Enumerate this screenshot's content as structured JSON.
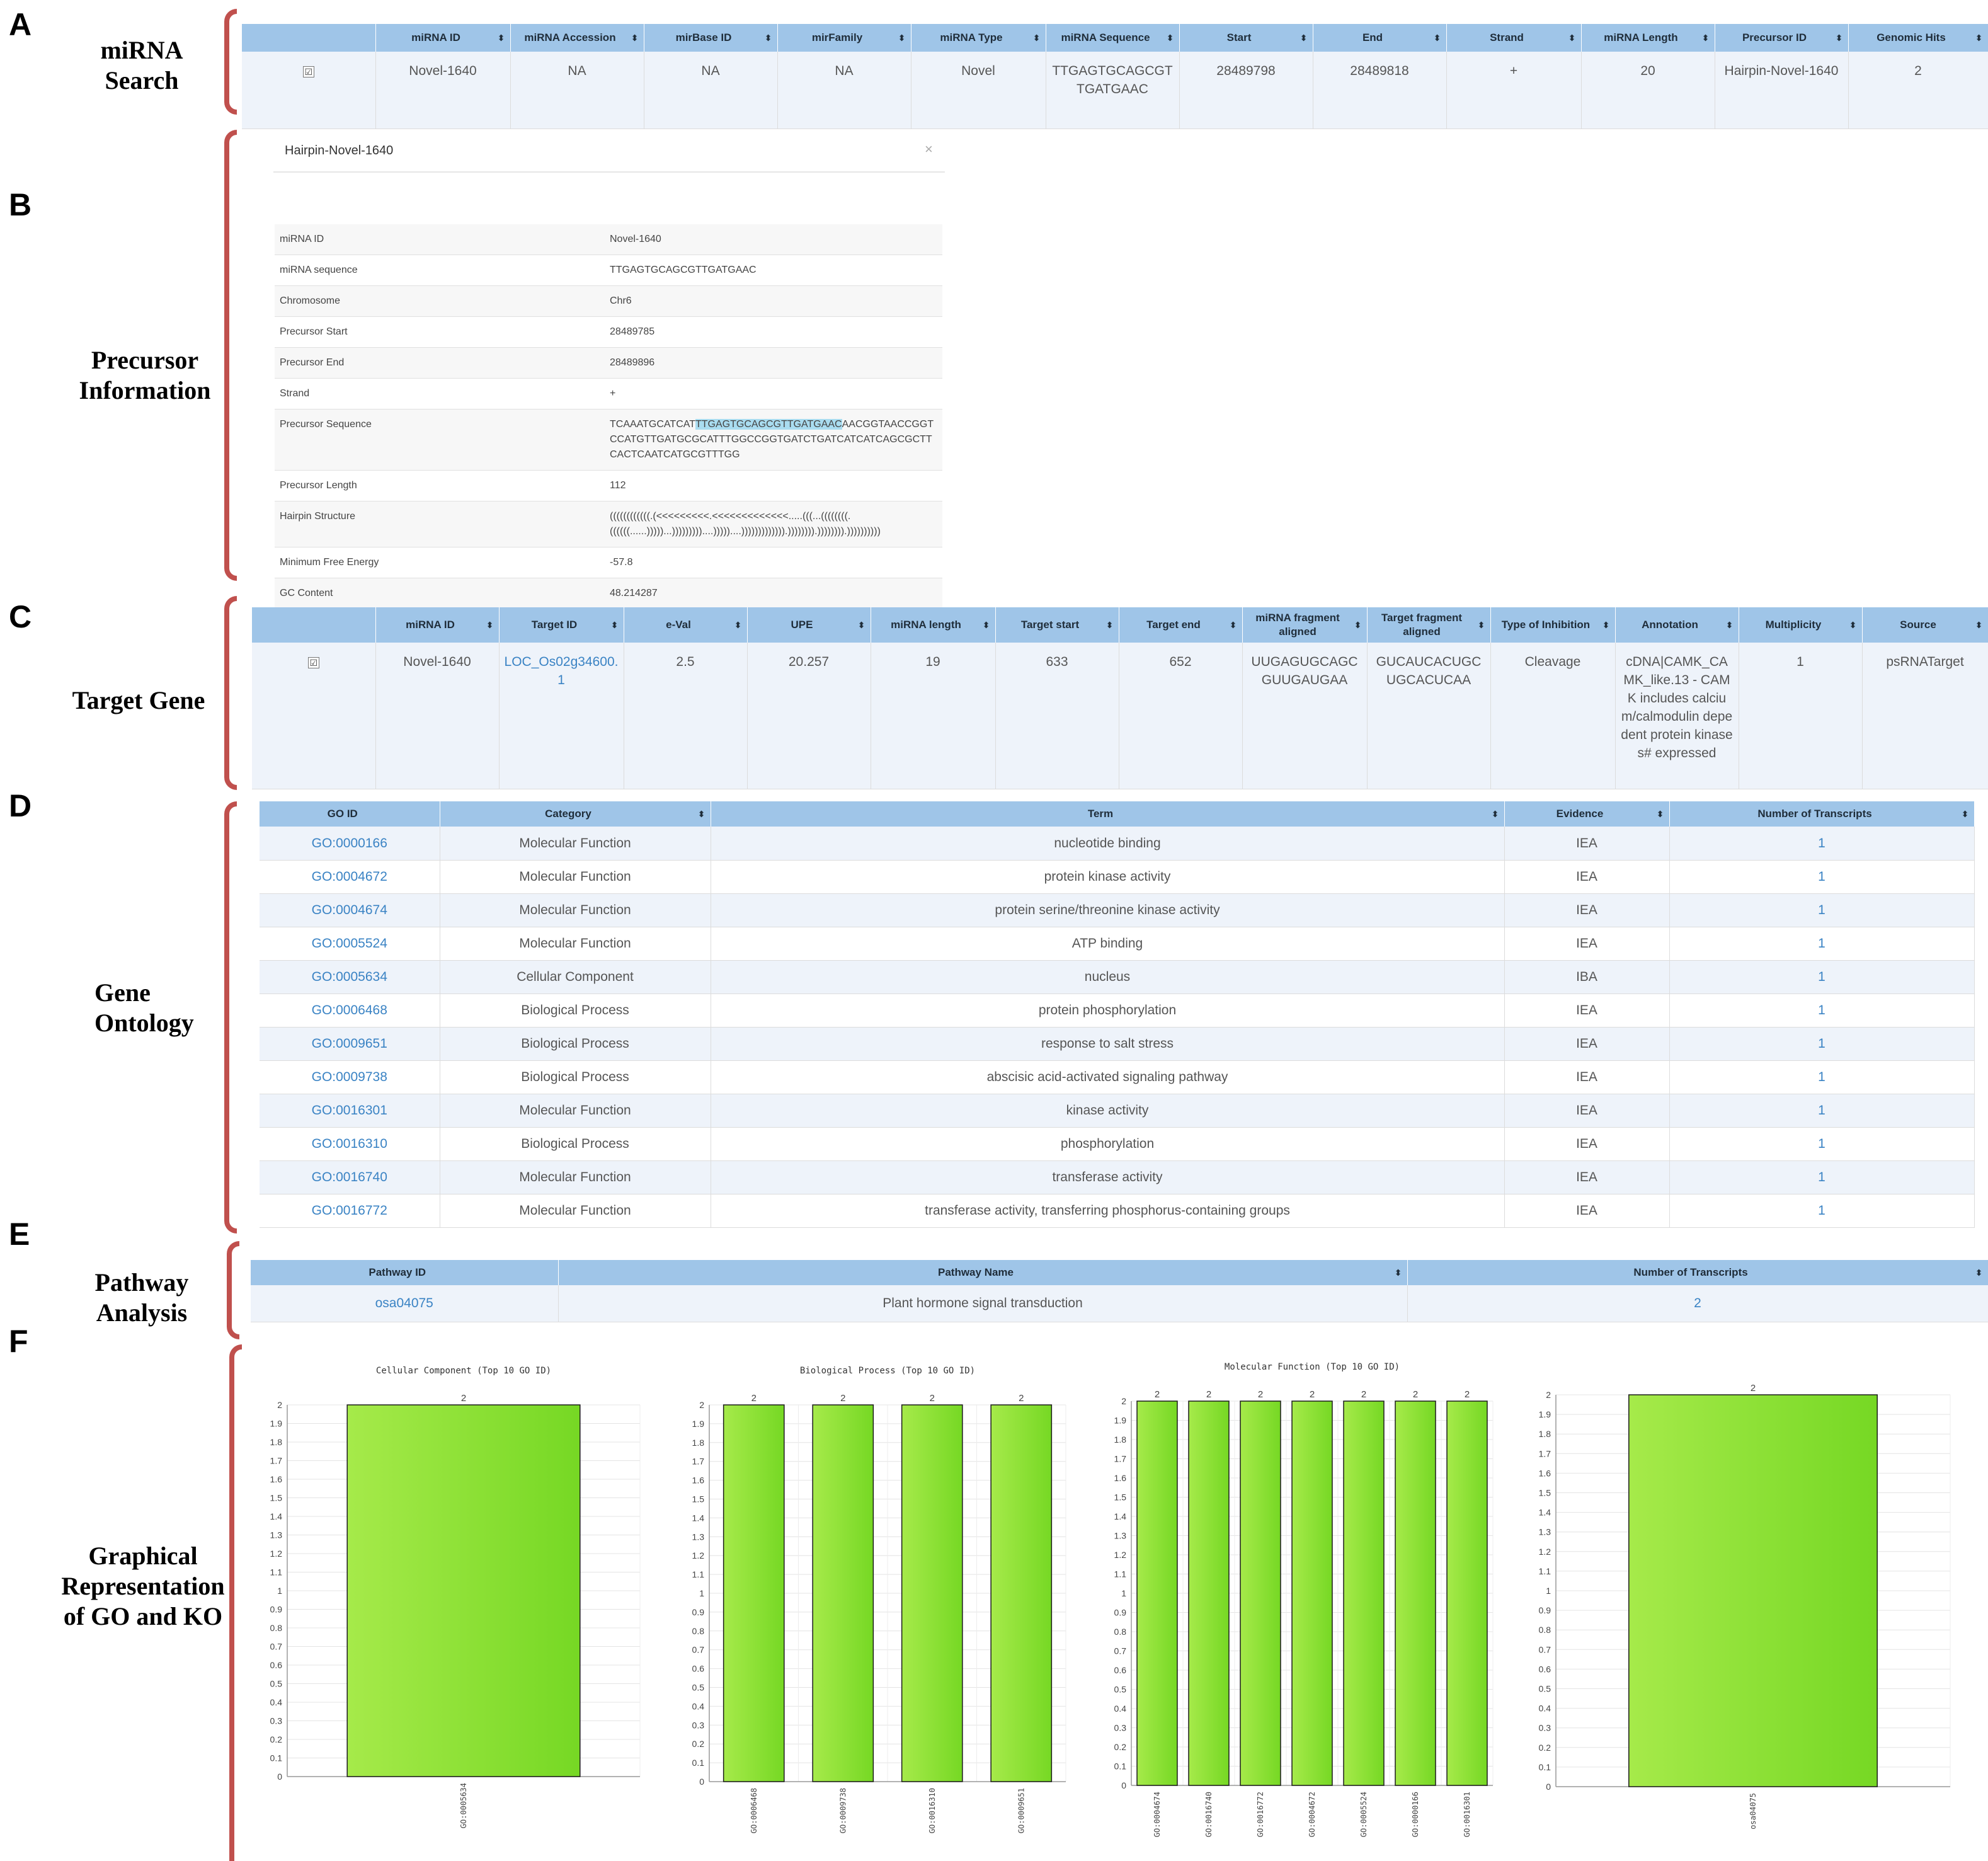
{
  "sections": {
    "a": {
      "letter": "A",
      "label": [
        "miRNA",
        "Search"
      ]
    },
    "b": {
      "letter": "B",
      "label": [
        "Precursor",
        "Information"
      ]
    },
    "c": {
      "letter": "C",
      "label": [
        "Target Gene"
      ]
    },
    "d": {
      "letter": "D",
      "label": [
        "Gene",
        "Ontology"
      ]
    },
    "e": {
      "letter": "E",
      "label": [
        "Pathway",
        "Analysis"
      ]
    },
    "f": {
      "letter": "F",
      "label": [
        "Graphical",
        "Representation",
        "of GO and KO"
      ]
    }
  },
  "mirna_search": {
    "headers": [
      "",
      "miRNA ID",
      "miRNA Accession",
      "mirBase ID",
      "mirFamily",
      "miRNA Type",
      "miRNA Sequence",
      "Start",
      "End",
      "Strand",
      "miRNA Length",
      "Precursor ID",
      "Genomic Hits"
    ],
    "row": [
      "Novel-1640",
      "NA",
      "NA",
      "NA",
      "Novel",
      "TTGAGTGCAGCGTTGATGAAC",
      "28489798",
      "28489818",
      "+",
      "20",
      "Hairpin-Novel-1640",
      "2"
    ]
  },
  "precursor": {
    "title": "Hairpin-Novel-1640",
    "close": "×",
    "rows": [
      {
        "label": "miRNA ID",
        "value": "Novel-1640"
      },
      {
        "label": "miRNA sequence",
        "value": "TTGAGTGCAGCGTTGATGAAC"
      },
      {
        "label": "Chromosome",
        "value": "Chr6"
      },
      {
        "label": "Precursor Start",
        "value": "28489785"
      },
      {
        "label": "Precursor End",
        "value": "28489896"
      },
      {
        "label": "Strand",
        "value": "+"
      },
      {
        "label": "Precursor Sequence",
        "value_pre": "TCAAATGCATCAT",
        "value_hl": "TTGAGTGCAGCGTTGATGAAC",
        "value_post": "AACGGTAACCGGTCCATGTTGATGCGCATTTGGCCGGTGATCTGATCATCATCAGCGCTTCACTCAATCATGCGTTTGG"
      },
      {
        "label": "Precursor Length",
        "value": "112"
      },
      {
        "label": "Hairpin Structure",
        "value": "((((((((((((.(<<<<<<<<<.<<<<<<<<<<<<<.....(((...((((((((.((((((......)))))...)))))))))....)))))....))))))))))))).)))))))).)))))))).))))))))))"
      },
      {
        "label": "Minimum Free Energy",
        "value": "-57.8"
      },
      {
        "label": "GC Content",
        "value": "48.214287"
      }
    ]
  },
  "target_gene": {
    "headers": [
      "",
      "miRNA ID",
      "Target ID",
      "e-Val",
      "UPE",
      "miRNA length",
      "Target start",
      "Target end",
      "miRNA fragment aligned",
      "Target fragment aligned",
      "Type of Inhibition",
      "Annotation",
      "Multiplicity",
      "Source"
    ],
    "row": [
      "Novel-1640",
      "LOC_Os02g34600.1",
      "2.5",
      "20.257",
      "19",
      "633",
      "652",
      "UUGAGUGCAGCGUUGAUGAA",
      "GUCAUCACUGCUGCACUCAA",
      "Cleavage",
      "cDNA|CAMK_CAMK_like.13 - CAMK includes calcium/calmodulin depedent protein kinases# expressed",
      "1",
      "psRNATarget"
    ]
  },
  "gene_ontology": {
    "headers": [
      "GO ID",
      "Category",
      "Term",
      "Evidence",
      "Number of Transcripts"
    ],
    "rows": [
      [
        "GO:0000166",
        "Molecular Function",
        "nucleotide binding",
        "IEA",
        "1"
      ],
      [
        "GO:0004672",
        "Molecular Function",
        "protein kinase activity",
        "IEA",
        "1"
      ],
      [
        "GO:0004674",
        "Molecular Function",
        "protein serine/threonine kinase activity",
        "IEA",
        "1"
      ],
      [
        "GO:0005524",
        "Molecular Function",
        "ATP binding",
        "IEA",
        "1"
      ],
      [
        "GO:0005634",
        "Cellular Component",
        "nucleus",
        "IBA",
        "1"
      ],
      [
        "GO:0006468",
        "Biological Process",
        "protein phosphorylation",
        "IEA",
        "1"
      ],
      [
        "GO:0009651",
        "Biological Process",
        "response to salt stress",
        "IEA",
        "1"
      ],
      [
        "GO:0009738",
        "Biological Process",
        "abscisic acid-activated signaling pathway",
        "IEA",
        "1"
      ],
      [
        "GO:0016301",
        "Molecular Function",
        "kinase activity",
        "IEA",
        "1"
      ],
      [
        "GO:0016310",
        "Biological Process",
        "phosphorylation",
        "IEA",
        "1"
      ],
      [
        "GO:0016740",
        "Molecular Function",
        "transferase activity",
        "IEA",
        "1"
      ],
      [
        "GO:0016772",
        "Molecular Function",
        "transferase activity, transferring phosphorus-containing groups",
        "IEA",
        "1"
      ]
    ]
  },
  "pathway": {
    "headers": [
      "Pathway ID",
      "Pathway Name",
      "Number of Transcripts"
    ],
    "rows": [
      [
        "osa04075",
        "Plant hormone signal transduction",
        "2"
      ]
    ]
  },
  "chart_data": [
    {
      "type": "bar",
      "title": "Cellular Component (Top 10 GO ID)",
      "categories": [
        "GO:0005634"
      ],
      "values": [
        2
      ],
      "ylim": [
        0,
        2
      ],
      "yticks": [
        "0",
        "0.1",
        "0.2",
        "0.3",
        "0.4",
        "0.5",
        "0.6",
        "0.7",
        "0.8",
        "0.9",
        "1",
        "1.1",
        "1.2",
        "1.3",
        "1.4",
        "1.5",
        "1.6",
        "1.7",
        "1.8",
        "1.9",
        "2"
      ],
      "grid": true,
      "bar_color": "#8fe03a"
    },
    {
      "type": "bar",
      "title": "Biological Process (Top 10 GO ID)",
      "categories": [
        "GO:0006468",
        "GO:0009738",
        "GO:0016310",
        "GO:0009651"
      ],
      "values": [
        2,
        2,
        2,
        2
      ],
      "ylim": [
        0,
        2
      ],
      "yticks": [
        "0",
        "0.1",
        "0.2",
        "0.3",
        "0.4",
        "0.5",
        "0.6",
        "0.7",
        "0.8",
        "0.9",
        "1",
        "1.1",
        "1.2",
        "1.3",
        "1.4",
        "1.5",
        "1.6",
        "1.7",
        "1.8",
        "1.9",
        "2"
      ],
      "grid": true,
      "bar_color": "#8fe03a"
    },
    {
      "type": "bar",
      "title": "Molecular Function (Top 10 GO ID)",
      "categories": [
        "GO:0004674",
        "GO:0016740",
        "GO:0016772",
        "GO:0004672",
        "GO:0005524",
        "GO:0000166",
        "GO:0016301"
      ],
      "values": [
        2,
        2,
        2,
        2,
        2,
        2,
        2
      ],
      "ylim": [
        0,
        2
      ],
      "yticks": [
        "0",
        "0.1",
        "0.2",
        "0.3",
        "0.4",
        "0.5",
        "0.6",
        "0.7",
        "0.8",
        "0.9",
        "1",
        "1.1",
        "1.2",
        "1.3",
        "1.4",
        "1.5",
        "1.6",
        "1.7",
        "1.8",
        "1.9",
        "2"
      ],
      "grid": true,
      "bar_color": "#8fe03a"
    },
    {
      "type": "bar",
      "title": "",
      "categories": [
        "osa04075"
      ],
      "values": [
        2
      ],
      "ylim": [
        0,
        2
      ],
      "yticks": [
        "0",
        "0.1",
        "0.2",
        "0.3",
        "0.4",
        "0.5",
        "0.6",
        "0.7",
        "0.8",
        "0.9",
        "1",
        "1.1",
        "1.2",
        "1.3",
        "1.4",
        "1.5",
        "1.6",
        "1.7",
        "1.8",
        "1.9",
        "2"
      ],
      "grid": true,
      "bar_color": "#8fe03a"
    }
  ]
}
